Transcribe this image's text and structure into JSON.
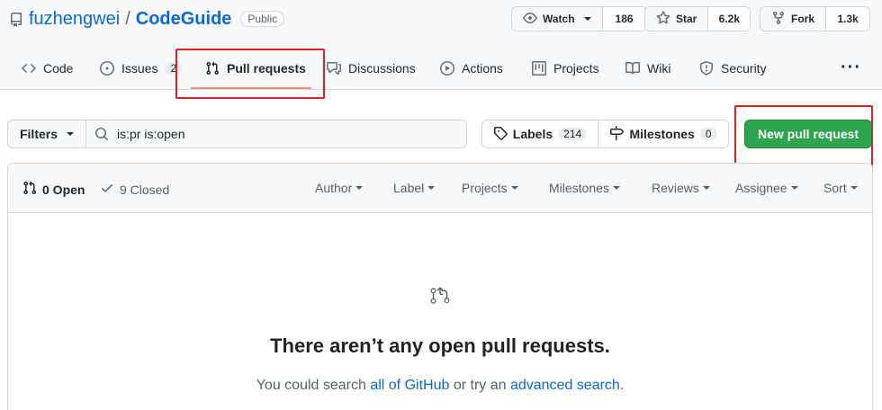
{
  "repo": {
    "owner": "fuzhengwei",
    "separator": "/",
    "name": "CodeGuide",
    "visibility": "Public"
  },
  "actions": {
    "watch": {
      "label": "Watch",
      "count": "186"
    },
    "star": {
      "label": "Star",
      "count": "6.2k"
    },
    "fork": {
      "label": "Fork",
      "count": "1.3k"
    }
  },
  "tabs": [
    {
      "label": "Code",
      "icon": "code-icon"
    },
    {
      "label": "Issues",
      "icon": "issue-icon",
      "count": "2"
    },
    {
      "label": "Pull requests",
      "icon": "pull-request-icon",
      "active": true
    },
    {
      "label": "Discussions",
      "icon": "discussions-icon"
    },
    {
      "label": "Actions",
      "icon": "play-icon"
    },
    {
      "label": "Projects",
      "icon": "project-icon"
    },
    {
      "label": "Wiki",
      "icon": "book-icon"
    },
    {
      "label": "Security",
      "icon": "shield-icon"
    }
  ],
  "filters": {
    "label": "Filters",
    "search_value": "is:pr is:open",
    "labels": {
      "label": "Labels",
      "count": "214"
    },
    "milestones": {
      "label": "Milestones",
      "count": "0"
    },
    "new_pr": "New pull request"
  },
  "pr_list": {
    "open_label": "0 Open",
    "closed_label": "9 Closed",
    "header_filters": [
      "Author",
      "Label",
      "Projects",
      "Milestones",
      "Reviews",
      "Assignee",
      "Sort"
    ],
    "blank_title": "There aren’t any open pull requests.",
    "blank_sub_prefix": "You could search ",
    "blank_link1": "all of GitHub",
    "blank_sub_middle": " or try an ",
    "blank_link2": "advanced search",
    "blank_sub_suffix": "."
  },
  "colors": {
    "accent_link": "#0969da",
    "primary_button": "#2da44e",
    "highlight_box": "#e02020",
    "active_tab_underline": "#fd8c73"
  }
}
